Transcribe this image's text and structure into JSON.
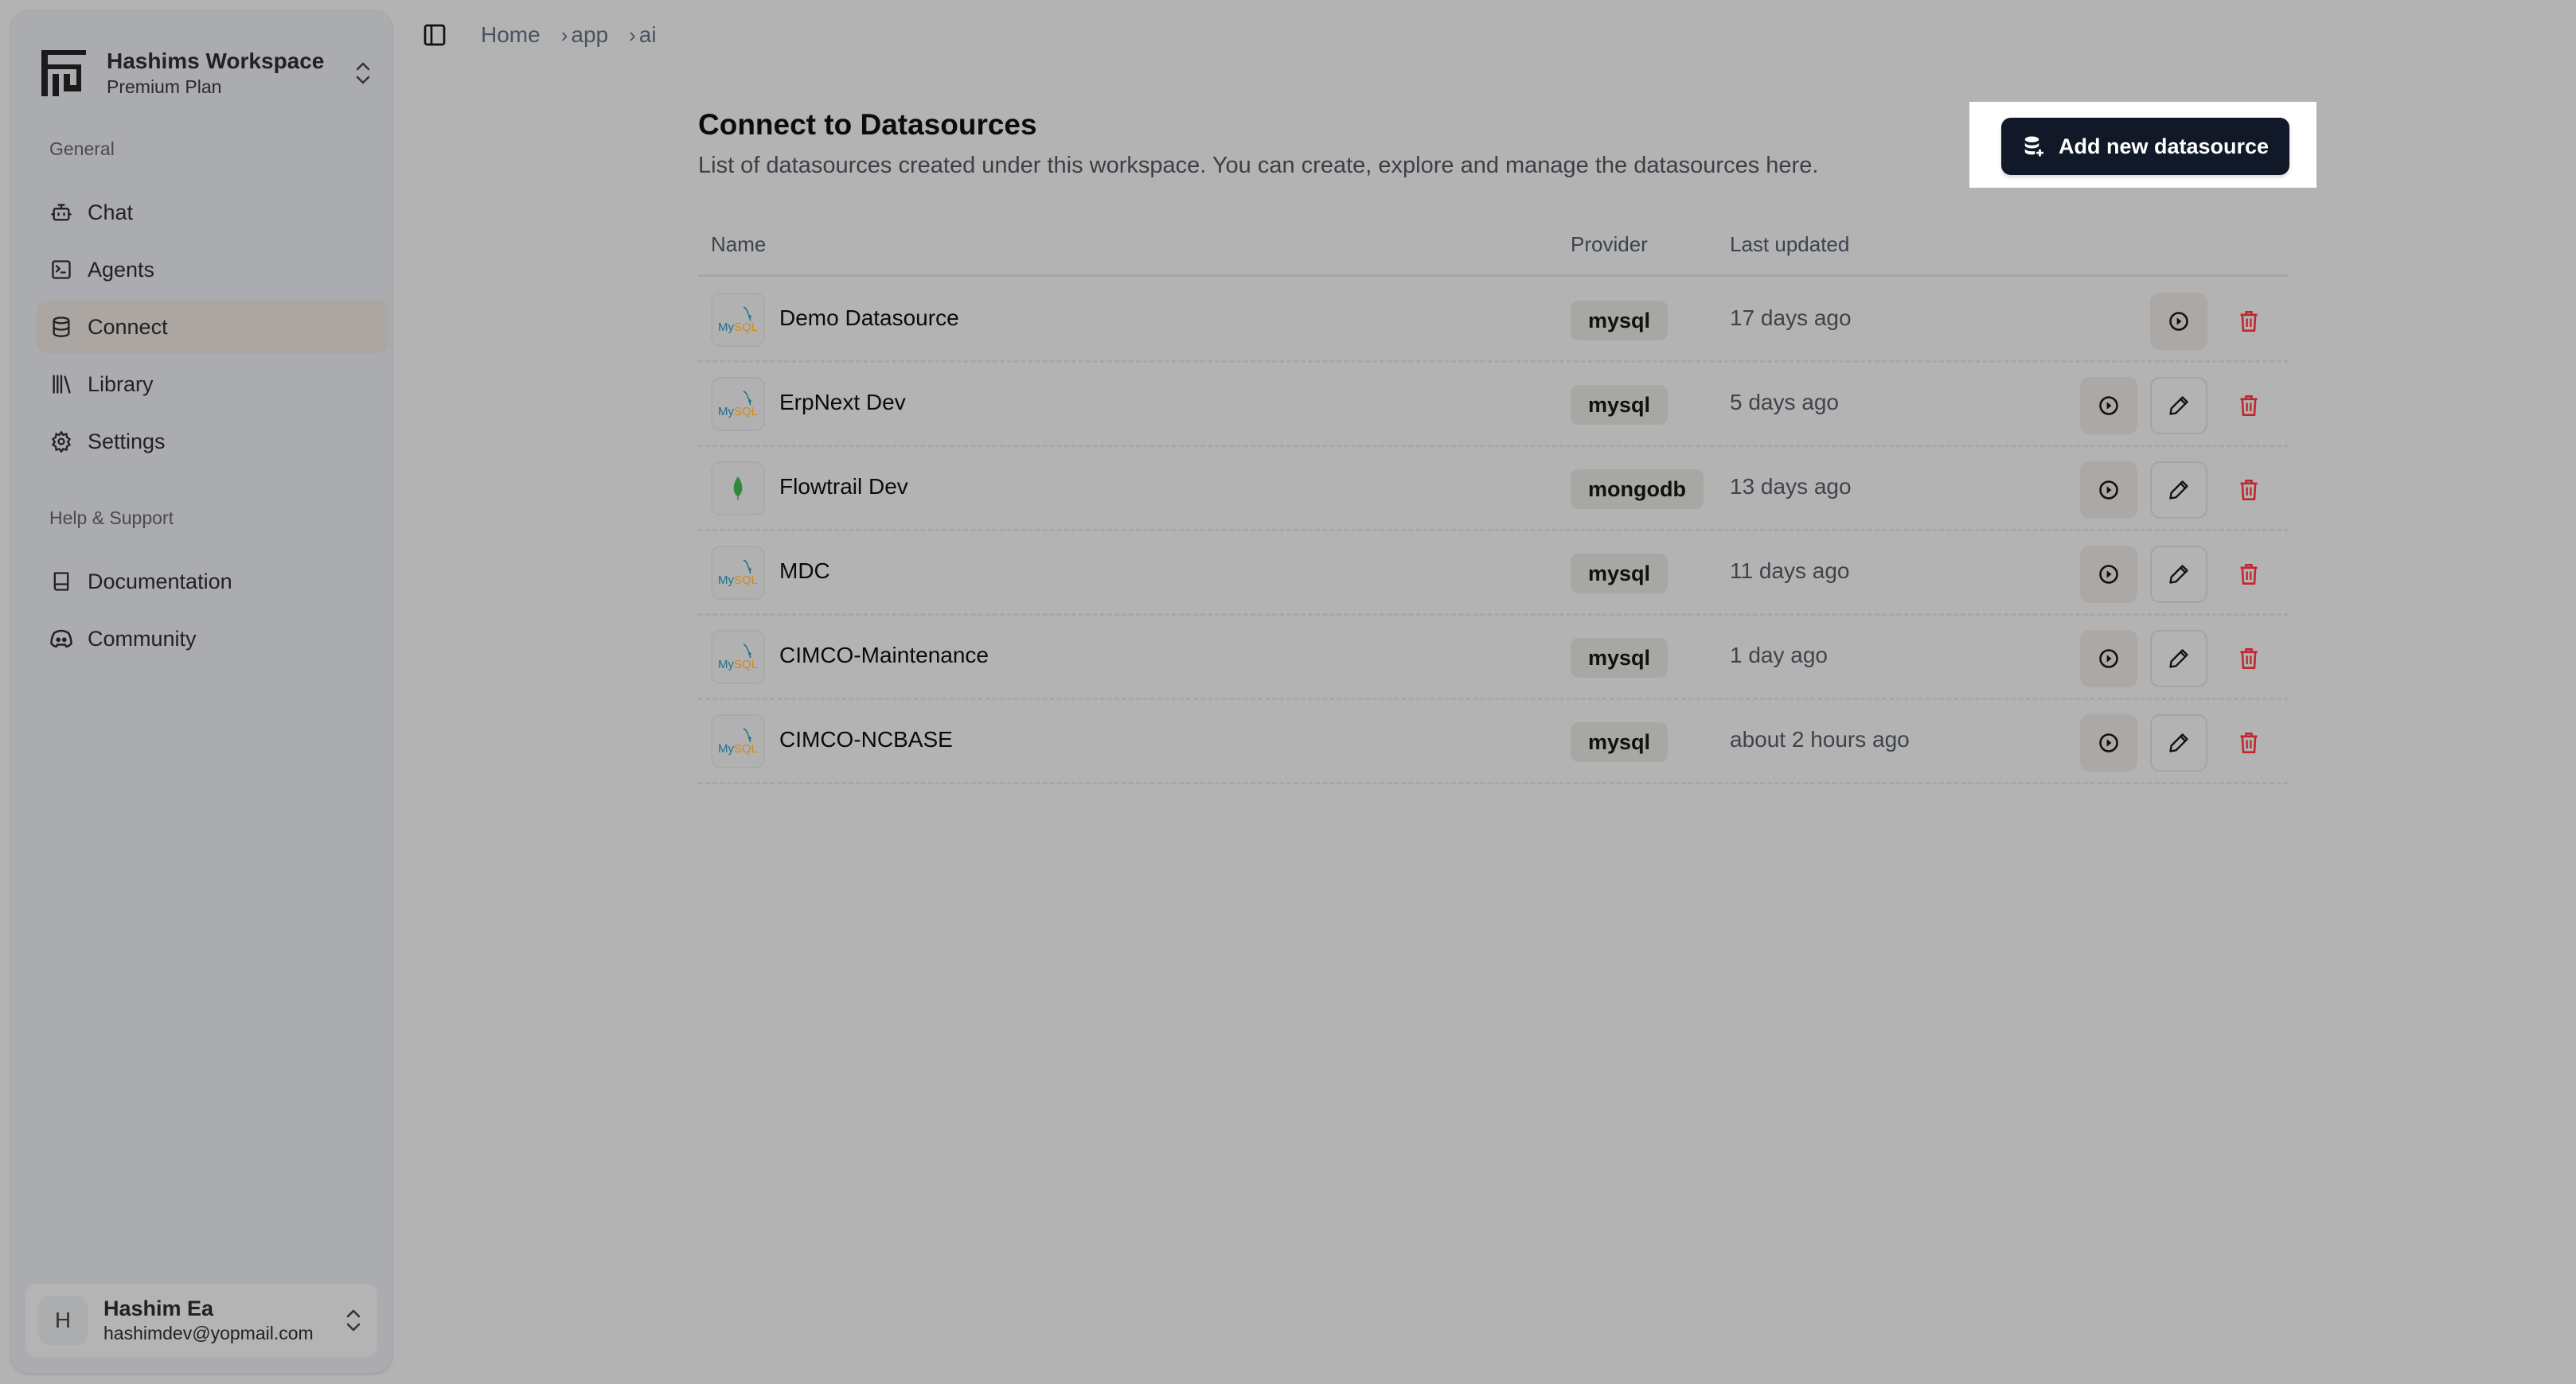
{
  "workspace": {
    "name": "Hashims Workspace",
    "plan": "Premium Plan"
  },
  "sidebar": {
    "sections": [
      {
        "label": "General",
        "items": [
          {
            "label": "Chat",
            "icon": "bot-icon",
            "active": false
          },
          {
            "label": "Agents",
            "icon": "terminal-icon",
            "active": false
          },
          {
            "label": "Connect",
            "icon": "database-icon",
            "active": true
          },
          {
            "label": "Library",
            "icon": "library-icon",
            "active": false
          },
          {
            "label": "Settings",
            "icon": "gear-icon",
            "active": false
          }
        ]
      },
      {
        "label": "Help & Support",
        "items": [
          {
            "label": "Documentation",
            "icon": "book-icon",
            "active": false
          },
          {
            "label": "Community",
            "icon": "discord-icon",
            "active": false
          }
        ]
      }
    ]
  },
  "user": {
    "initial": "H",
    "name": "Hashim Ea",
    "email": "hashimdev@yopmail.com"
  },
  "breadcrumb": [
    "Home",
    "app",
    "ai"
  ],
  "main": {
    "title": "Connect to Datasources",
    "description": "List of datasources created under this workspace. You can create, explore and manage the datasources here.",
    "add_button_label": "Add new datasource",
    "table": {
      "columns": [
        "Name",
        "Provider",
        "Last updated"
      ],
      "rows": [
        {
          "name": "Demo Datasource",
          "provider": "mysql",
          "updated": "17 days ago",
          "editable": false
        },
        {
          "name": "ErpNext Dev",
          "provider": "mysql",
          "updated": "5 days ago",
          "editable": true
        },
        {
          "name": "Flowtrail Dev",
          "provider": "mongodb",
          "updated": "13 days ago",
          "editable": true
        },
        {
          "name": "MDC",
          "provider": "mysql",
          "updated": "11 days ago",
          "editable": true
        },
        {
          "name": "CIMCO-Maintenance",
          "provider": "mysql",
          "updated": "1 day ago",
          "editable": true
        },
        {
          "name": "CIMCO-NCBASE",
          "provider": "mysql",
          "updated": "about 2 hours ago",
          "editable": true
        }
      ]
    }
  },
  "colors": {
    "primary_button": "#111827",
    "delete": "#c0262d",
    "overlay": "#b3b3b3",
    "active_nav": "#aba6a2"
  }
}
